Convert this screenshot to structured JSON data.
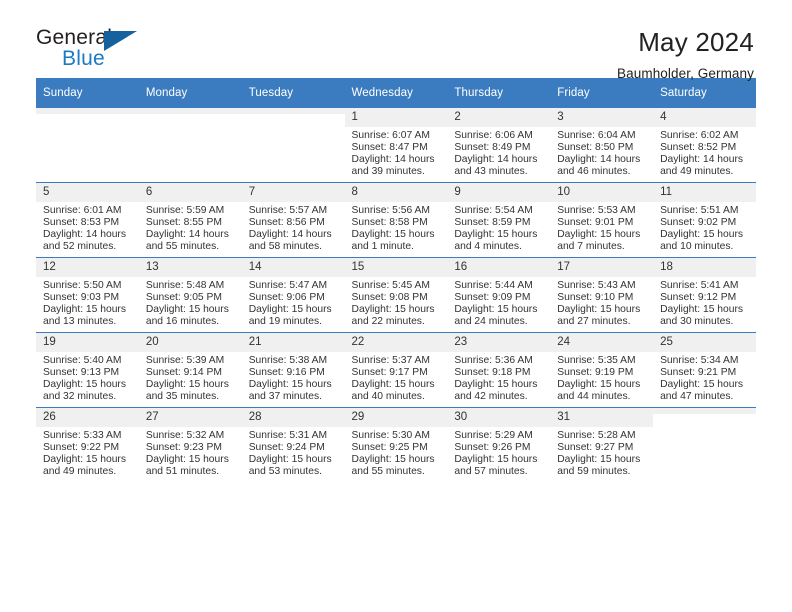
{
  "logo": {
    "word_one": "General",
    "word_two": "Blue",
    "accent_color": "#15619e",
    "blue_text_color": "#1a7ac4"
  },
  "header": {
    "title": "May 2024",
    "subtitle": "Baumholder, Germany"
  },
  "calendar": {
    "header_color": "#3b7cc0",
    "weekday_headers": [
      "Sunday",
      "Monday",
      "Tuesday",
      "Wednesday",
      "Thursday",
      "Friday",
      "Saturday"
    ],
    "weeks": [
      [
        {
          "day": "",
          "blank": true
        },
        {
          "day": "",
          "blank": true
        },
        {
          "day": "",
          "blank": true
        },
        {
          "day": "1",
          "sunrise": "Sunrise: 6:07 AM",
          "sunset": "Sunset: 8:47 PM",
          "daylight_line1": "Daylight: 14 hours",
          "daylight_line2": "and 39 minutes."
        },
        {
          "day": "2",
          "sunrise": "Sunrise: 6:06 AM",
          "sunset": "Sunset: 8:49 PM",
          "daylight_line1": "Daylight: 14 hours",
          "daylight_line2": "and 43 minutes."
        },
        {
          "day": "3",
          "sunrise": "Sunrise: 6:04 AM",
          "sunset": "Sunset: 8:50 PM",
          "daylight_line1": "Daylight: 14 hours",
          "daylight_line2": "and 46 minutes."
        },
        {
          "day": "4",
          "sunrise": "Sunrise: 6:02 AM",
          "sunset": "Sunset: 8:52 PM",
          "daylight_line1": "Daylight: 14 hours",
          "daylight_line2": "and 49 minutes."
        }
      ],
      [
        {
          "day": "5",
          "sunrise": "Sunrise: 6:01 AM",
          "sunset": "Sunset: 8:53 PM",
          "daylight_line1": "Daylight: 14 hours",
          "daylight_line2": "and 52 minutes."
        },
        {
          "day": "6",
          "sunrise": "Sunrise: 5:59 AM",
          "sunset": "Sunset: 8:55 PM",
          "daylight_line1": "Daylight: 14 hours",
          "daylight_line2": "and 55 minutes."
        },
        {
          "day": "7",
          "sunrise": "Sunrise: 5:57 AM",
          "sunset": "Sunset: 8:56 PM",
          "daylight_line1": "Daylight: 14 hours",
          "daylight_line2": "and 58 minutes."
        },
        {
          "day": "8",
          "sunrise": "Sunrise: 5:56 AM",
          "sunset": "Sunset: 8:58 PM",
          "daylight_line1": "Daylight: 15 hours",
          "daylight_line2": "and 1 minute."
        },
        {
          "day": "9",
          "sunrise": "Sunrise: 5:54 AM",
          "sunset": "Sunset: 8:59 PM",
          "daylight_line1": "Daylight: 15 hours",
          "daylight_line2": "and 4 minutes."
        },
        {
          "day": "10",
          "sunrise": "Sunrise: 5:53 AM",
          "sunset": "Sunset: 9:01 PM",
          "daylight_line1": "Daylight: 15 hours",
          "daylight_line2": "and 7 minutes."
        },
        {
          "day": "11",
          "sunrise": "Sunrise: 5:51 AM",
          "sunset": "Sunset: 9:02 PM",
          "daylight_line1": "Daylight: 15 hours",
          "daylight_line2": "and 10 minutes."
        }
      ],
      [
        {
          "day": "12",
          "sunrise": "Sunrise: 5:50 AM",
          "sunset": "Sunset: 9:03 PM",
          "daylight_line1": "Daylight: 15 hours",
          "daylight_line2": "and 13 minutes."
        },
        {
          "day": "13",
          "sunrise": "Sunrise: 5:48 AM",
          "sunset": "Sunset: 9:05 PM",
          "daylight_line1": "Daylight: 15 hours",
          "daylight_line2": "and 16 minutes."
        },
        {
          "day": "14",
          "sunrise": "Sunrise: 5:47 AM",
          "sunset": "Sunset: 9:06 PM",
          "daylight_line1": "Daylight: 15 hours",
          "daylight_line2": "and 19 minutes."
        },
        {
          "day": "15",
          "sunrise": "Sunrise: 5:45 AM",
          "sunset": "Sunset: 9:08 PM",
          "daylight_line1": "Daylight: 15 hours",
          "daylight_line2": "and 22 minutes."
        },
        {
          "day": "16",
          "sunrise": "Sunrise: 5:44 AM",
          "sunset": "Sunset: 9:09 PM",
          "daylight_line1": "Daylight: 15 hours",
          "daylight_line2": "and 24 minutes."
        },
        {
          "day": "17",
          "sunrise": "Sunrise: 5:43 AM",
          "sunset": "Sunset: 9:10 PM",
          "daylight_line1": "Daylight: 15 hours",
          "daylight_line2": "and 27 minutes."
        },
        {
          "day": "18",
          "sunrise": "Sunrise: 5:41 AM",
          "sunset": "Sunset: 9:12 PM",
          "daylight_line1": "Daylight: 15 hours",
          "daylight_line2": "and 30 minutes."
        }
      ],
      [
        {
          "day": "19",
          "sunrise": "Sunrise: 5:40 AM",
          "sunset": "Sunset: 9:13 PM",
          "daylight_line1": "Daylight: 15 hours",
          "daylight_line2": "and 32 minutes."
        },
        {
          "day": "20",
          "sunrise": "Sunrise: 5:39 AM",
          "sunset": "Sunset: 9:14 PM",
          "daylight_line1": "Daylight: 15 hours",
          "daylight_line2": "and 35 minutes."
        },
        {
          "day": "21",
          "sunrise": "Sunrise: 5:38 AM",
          "sunset": "Sunset: 9:16 PM",
          "daylight_line1": "Daylight: 15 hours",
          "daylight_line2": "and 37 minutes."
        },
        {
          "day": "22",
          "sunrise": "Sunrise: 5:37 AM",
          "sunset": "Sunset: 9:17 PM",
          "daylight_line1": "Daylight: 15 hours",
          "daylight_line2": "and 40 minutes."
        },
        {
          "day": "23",
          "sunrise": "Sunrise: 5:36 AM",
          "sunset": "Sunset: 9:18 PM",
          "daylight_line1": "Daylight: 15 hours",
          "daylight_line2": "and 42 minutes."
        },
        {
          "day": "24",
          "sunrise": "Sunrise: 5:35 AM",
          "sunset": "Sunset: 9:19 PM",
          "daylight_line1": "Daylight: 15 hours",
          "daylight_line2": "and 44 minutes."
        },
        {
          "day": "25",
          "sunrise": "Sunrise: 5:34 AM",
          "sunset": "Sunset: 9:21 PM",
          "daylight_line1": "Daylight: 15 hours",
          "daylight_line2": "and 47 minutes."
        }
      ],
      [
        {
          "day": "26",
          "sunrise": "Sunrise: 5:33 AM",
          "sunset": "Sunset: 9:22 PM",
          "daylight_line1": "Daylight: 15 hours",
          "daylight_line2": "and 49 minutes."
        },
        {
          "day": "27",
          "sunrise": "Sunrise: 5:32 AM",
          "sunset": "Sunset: 9:23 PM",
          "daylight_line1": "Daylight: 15 hours",
          "daylight_line2": "and 51 minutes."
        },
        {
          "day": "28",
          "sunrise": "Sunrise: 5:31 AM",
          "sunset": "Sunset: 9:24 PM",
          "daylight_line1": "Daylight: 15 hours",
          "daylight_line2": "and 53 minutes."
        },
        {
          "day": "29",
          "sunrise": "Sunrise: 5:30 AM",
          "sunset": "Sunset: 9:25 PM",
          "daylight_line1": "Daylight: 15 hours",
          "daylight_line2": "and 55 minutes."
        },
        {
          "day": "30",
          "sunrise": "Sunrise: 5:29 AM",
          "sunset": "Sunset: 9:26 PM",
          "daylight_line1": "Daylight: 15 hours",
          "daylight_line2": "and 57 minutes."
        },
        {
          "day": "31",
          "sunrise": "Sunrise: 5:28 AM",
          "sunset": "Sunset: 9:27 PM",
          "daylight_line1": "Daylight: 15 hours",
          "daylight_line2": "and 59 minutes."
        },
        {
          "day": "",
          "blank": true
        }
      ]
    ]
  }
}
